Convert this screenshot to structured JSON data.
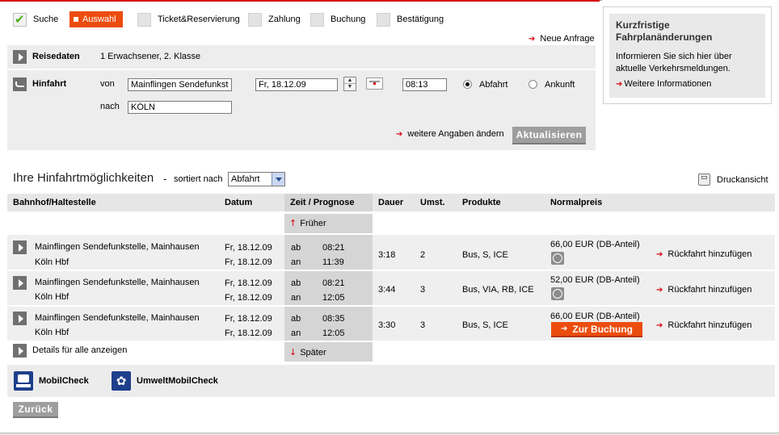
{
  "steps": [
    {
      "label": "Suche",
      "state": "done"
    },
    {
      "label": "Auswahl",
      "state": "active"
    },
    {
      "label": "Ticket&Reservierung",
      "state": "todo"
    },
    {
      "label": "Zahlung",
      "state": "todo"
    },
    {
      "label": "Buchung",
      "state": "todo"
    },
    {
      "label": "Bestätigung",
      "state": "todo"
    }
  ],
  "neue_anfrage": "Neue Anfrage",
  "reisedaten": {
    "label": "Reisedaten",
    "value": "1 Erwachsener, 2. Klasse"
  },
  "hinfahrt": {
    "label": "Hinfahrt",
    "von_label": "von",
    "von_value": "Mainflingen Sendefunkste",
    "date_value": "Fr, 18.12.09",
    "time_value": "08:13",
    "abfahrt": "Abfahrt",
    "ankunft": "Ankunft",
    "nach_label": "nach",
    "nach_value": "KÖLN",
    "weitere": "weitere Angaben ändern",
    "aktualisieren": "Aktualisieren"
  },
  "infobox": {
    "title": "Kurzfristige Fahrplanänderungen",
    "text": "Informieren Sie sich hier über aktuelle Verkehrsmeldungen.",
    "link": "Weitere Informationen"
  },
  "results": {
    "title": "Ihre Hinfahrtmöglichkeiten",
    "dash": "-",
    "sort_label": "sortiert nach",
    "sort_value": "Abfahrt",
    "print": "Druckansicht",
    "headers": {
      "station": "Bahnhof/Haltestelle",
      "datum": "Datum",
      "zeit": "Zeit / Prognose",
      "dauer": "Dauer",
      "umst": "Umst.",
      "produkte": "Produkte",
      "preis": "Normalpreis"
    },
    "frueher": "Früher",
    "spaeter": "Später",
    "details_all": "Details für alle anzeigen",
    "connections": [
      {
        "from": "Mainflingen Sendefunkstelle, Mainhausen",
        "to": "Köln Hbf",
        "date1": "Fr, 18.12.09",
        "date2": "Fr, 18.12.09",
        "ab": "ab",
        "an": "an",
        "dep": "08:21",
        "arr": "11:39",
        "dauer": "3:18",
        "umst": "2",
        "produkte": "Bus, S, ICE",
        "preis": "66,00 EUR (DB-Anteil)",
        "rueck": "Rückfahrt hinzufügen"
      },
      {
        "from": "Mainflingen Sendefunkstelle, Mainhausen",
        "to": "Köln Hbf",
        "date1": "Fr, 18.12.09",
        "date2": "Fr, 18.12.09",
        "ab": "ab",
        "an": "an",
        "dep": "08:21",
        "arr": "12:05",
        "dauer": "3:44",
        "umst": "3",
        "produkte": "Bus, VIA, RB, ICE",
        "preis": "52,00 EUR (DB-Anteil)",
        "rueck": "Rückfahrt hinzufügen"
      },
      {
        "from": "Mainflingen Sendefunkstelle, Mainhausen",
        "to": "Köln Hbf",
        "date1": "Fr, 18.12.09",
        "date2": "Fr, 18.12.09",
        "ab": "ab",
        "an": "an",
        "dep": "08:35",
        "arr": "12:05",
        "dauer": "3:30",
        "umst": "3",
        "produkte": "Bus, S, ICE",
        "preis": "66,00 EUR (DB-Anteil)",
        "rueck": "Rückfahrt hinzufügen",
        "booking": "Zur Buchung"
      }
    ]
  },
  "footer": {
    "mobilcheck": "MobilCheck",
    "umwelt": "UmweltMobilCheck",
    "zurueck": "Zurück"
  },
  "colors": {
    "accent": "#ec4d0e",
    "red": "#d7000f",
    "panel": "#ededed"
  }
}
